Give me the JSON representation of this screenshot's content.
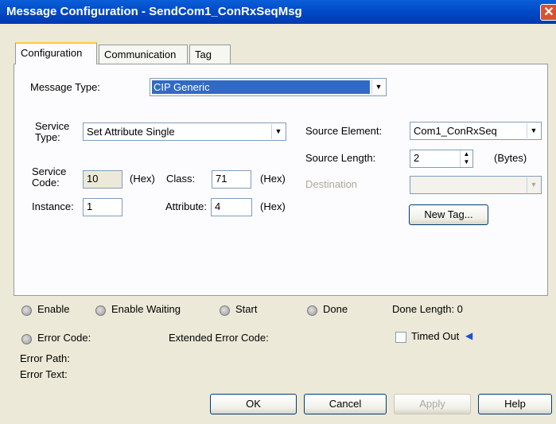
{
  "window": {
    "title": "Message Configuration - SendCom1_ConRxSeqMsg",
    "close_glyph": "✕"
  },
  "tabs": [
    {
      "label": "Configuration"
    },
    {
      "label": "Communication"
    },
    {
      "label": "Tag"
    }
  ],
  "config": {
    "message_type_label": "Message Type:",
    "message_type_value": "CIP Generic",
    "service_type_label_1": "Service",
    "service_type_label_2": "Type:",
    "service_type_value": "Set Attribute Single",
    "service_code_label_1": "Service",
    "service_code_label_2": "Code:",
    "service_code_value": "10",
    "hex_label": "(Hex)",
    "class_label": "Class:",
    "class_value": "71",
    "instance_label": "Instance:",
    "instance_value": "1",
    "attribute_label": "Attribute:",
    "attribute_value": "4",
    "source_element_label": "Source Element:",
    "source_element_value": "Com1_ConRxSeq",
    "source_length_label": "Source Length:",
    "source_length_value": "2",
    "bytes_label": "(Bytes)",
    "destination_label": "Destination",
    "destination_value": "",
    "new_tag_label": "New Tag..."
  },
  "status": {
    "enable": "Enable",
    "enable_waiting": "Enable Waiting",
    "start": "Start",
    "done": "Done",
    "done_length": "Done Length: 0",
    "error_code": "Error Code:",
    "extended_error_code": "Extended Error Code:",
    "timed_out": "Timed Out",
    "error_path": "Error Path:",
    "error_text": "Error Text:"
  },
  "buttons": {
    "ok": "OK",
    "cancel": "Cancel",
    "apply": "Apply",
    "help": "Help"
  }
}
